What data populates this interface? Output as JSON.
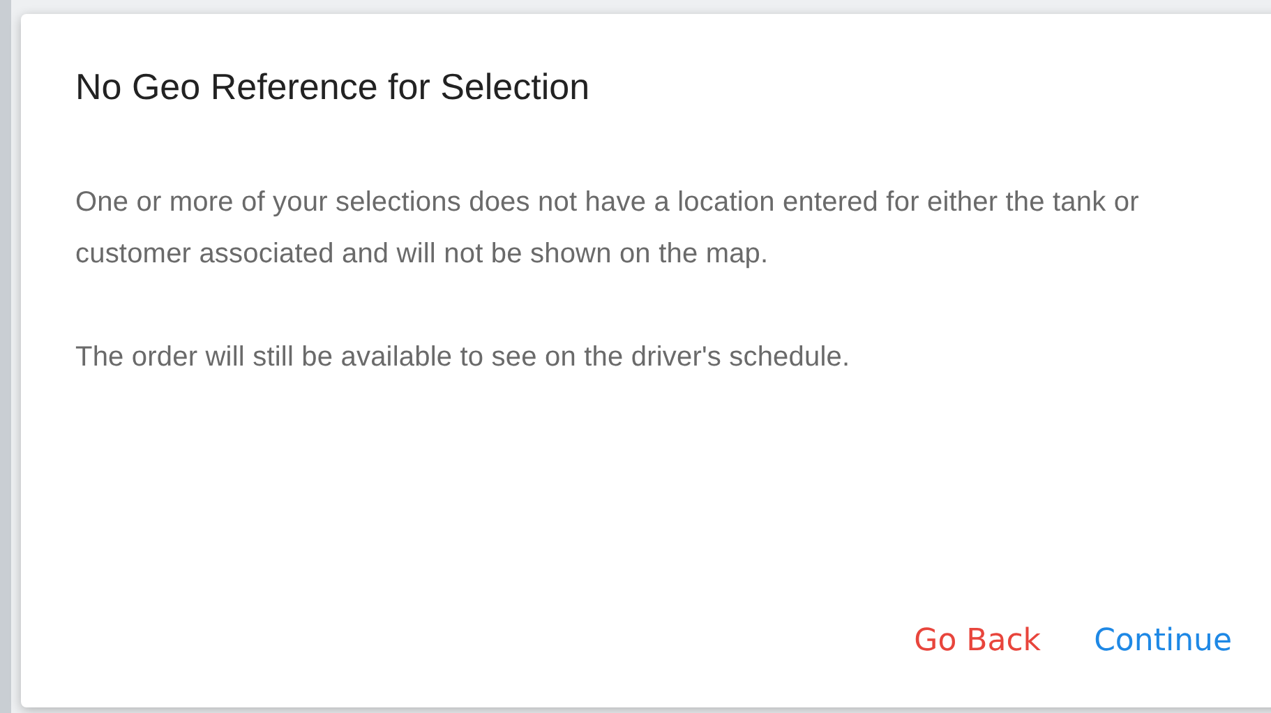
{
  "dialog": {
    "title": "No Geo Reference for Selection",
    "paragraphs": [
      "One or more of your selections does not have a location entered for either the tank or customer associated and will not be shown on the map.",
      "The order will still be available to see on the driver's schedule."
    ],
    "buttons": [
      {
        "label": "Go Back",
        "kind": "cancel"
      },
      {
        "label": "Continue",
        "kind": "confirm"
      }
    ]
  }
}
